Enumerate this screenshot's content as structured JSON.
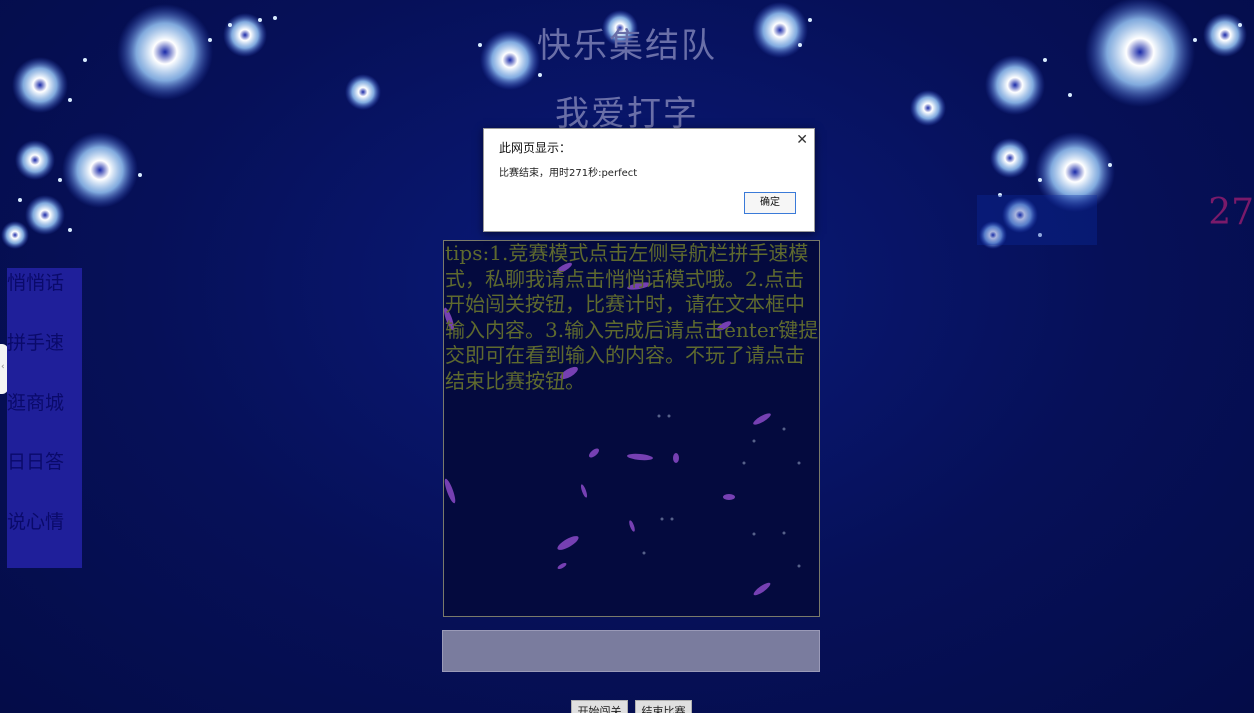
{
  "header": {
    "title": "快乐集结队",
    "subtitle": "我爱打字"
  },
  "timer": {
    "value": "27"
  },
  "sidebar": {
    "items": [
      {
        "label": "悄悄话"
      },
      {
        "label": "拼手速"
      },
      {
        "label": "逛商城"
      },
      {
        "label": "日日答"
      },
      {
        "label": "说心情"
      }
    ]
  },
  "main": {
    "tips": "tips:1.竞赛模式点击左侧导航栏拼手速模式，私聊我请点击悄悄话模式哦。2.点击开始闯关按钮，比赛计时，请在文本框中输入内容。3.输入完成后请点击enter键提交即可在看到输入的内容。不玩了请点击结束比赛按钮。",
    "input_value": "",
    "start_button": "开始闯关",
    "end_button": "结束比赛"
  },
  "dialog": {
    "title": "此网页显示：",
    "message": "比赛结束，用时271秒:perfect",
    "ok_label": "确定",
    "close_icon": "close-icon"
  },
  "colors": {
    "background": "#061058",
    "sidebar": "#1f1f9a",
    "title_text": "#6a6fa8",
    "tips_text": "#5f6a2e",
    "input_bg": "#7a7c9e",
    "timer_text": "#7a1a6a"
  }
}
